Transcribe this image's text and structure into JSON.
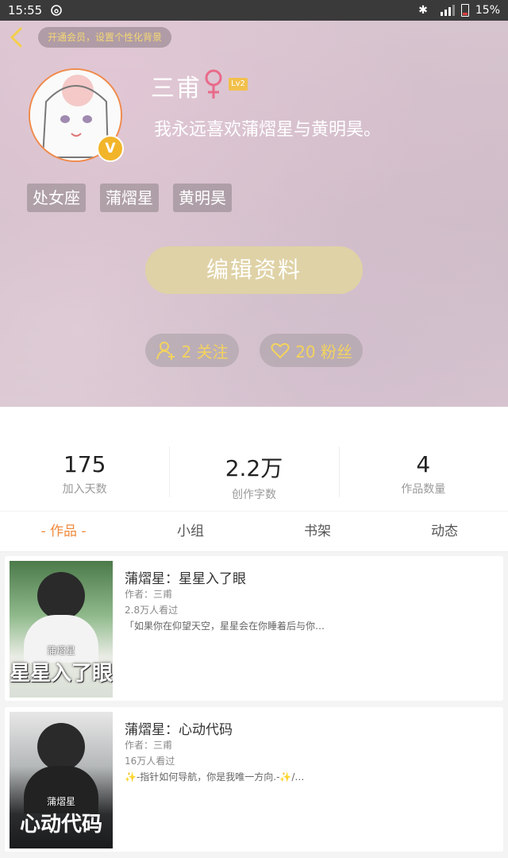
{
  "status_bar": {
    "time": "15:55",
    "battery": "15%",
    "icons": [
      "netease-music-icon",
      "bluetooth-icon",
      "signal-icon",
      "battery-icon"
    ]
  },
  "header": {
    "vip_banner": "开通会员，设置个性化背景",
    "name": "三甫",
    "gender_icon": "female-icon",
    "level": "Lv2",
    "bio": "我永远喜欢蒲熠星与黄明昊。",
    "vip_badge": "V",
    "tags": [
      "处女座",
      "蒲熠星",
      "黄明昊"
    ],
    "edit_button": "编辑资料",
    "follow_count": "2 关注",
    "fans_count": "20 粉丝"
  },
  "stats": [
    {
      "value": "175",
      "label": "加入天数"
    },
    {
      "value": "2.2万",
      "label": "创作字数"
    },
    {
      "value": "4",
      "label": "作品数量"
    }
  ],
  "tabs": [
    "- 作品 -",
    "小组",
    "书架",
    "动态"
  ],
  "works": [
    {
      "title": "蒲熠星：星星入了眼",
      "author": "作者：三甫",
      "views": "2.8万人看过",
      "desc": "「如果你在仰望天空，星星会在你睡着后与你…",
      "cover_text": "星星入了眼",
      "cover_sub": "蒲熠星"
    },
    {
      "title": "蒲熠星：心动代码",
      "author": "作者：三甫",
      "views": "16万人看过",
      "desc": "✨-指针如何导航，你是我唯一方向.-✨/…",
      "cover_text": "心动代码",
      "cover_sub": "蒲熠星"
    }
  ],
  "colors": {
    "accent": "#f08a3c",
    "gold": "#f3d35e",
    "edit_button": "#dfd2a6",
    "avatar_border": "#f08a4b"
  }
}
